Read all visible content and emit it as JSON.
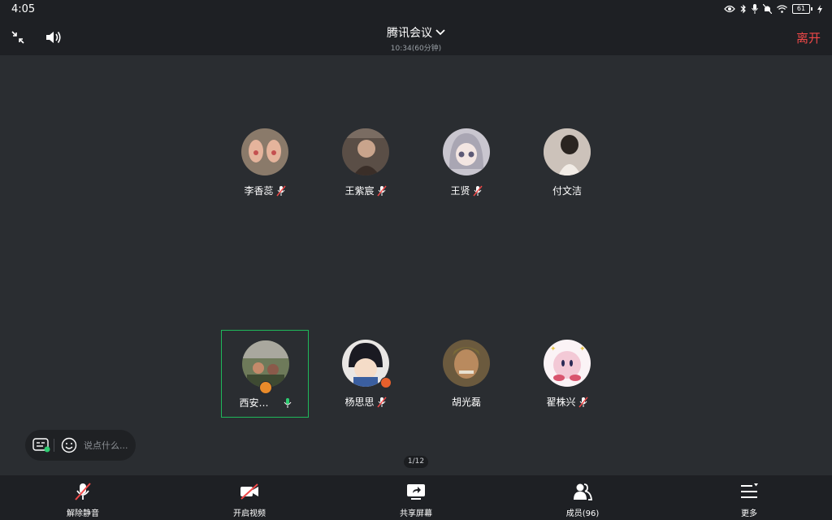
{
  "status_bar": {
    "time": "4:05",
    "battery": "61",
    "icons": [
      "eye-icon",
      "bluetooth-icon",
      "mic-icon",
      "mute-bell-icon",
      "wifi-icon",
      "battery-icon",
      "charging-icon"
    ]
  },
  "header": {
    "title": "腾讯会议",
    "subtitle": "10:34(60分钟)",
    "leave_label": "离开"
  },
  "participants": [
    {
      "name": "李香蕊",
      "mic": "muted",
      "avatar_color": "#8a7a6a"
    },
    {
      "name": "王紫宸",
      "mic": "muted",
      "avatar_color": "#5a4e46"
    },
    {
      "name": "王贤",
      "mic": "muted",
      "avatar_color": "#c9c6cf"
    },
    {
      "name": "付文洁",
      "mic": "none",
      "avatar_color": "#b8aaa0"
    },
    {
      "name": "西安…",
      "mic": "on",
      "avatar_color": "#6e7a5a",
      "active": true,
      "host": true
    },
    {
      "name": "杨思思",
      "mic": "muted",
      "avatar_color": "#e9e6e4"
    },
    {
      "name": "胡光磊",
      "mic": "none",
      "avatar_color": "#6b5a3e"
    },
    {
      "name": "翟株兴",
      "mic": "muted",
      "avatar_color": "#f3c9d6"
    }
  ],
  "chat": {
    "placeholder": "说点什么..."
  },
  "pager": {
    "text": "1/12"
  },
  "toolbar": {
    "unmute_label": "解除静音",
    "video_label": "开启视频",
    "share_label": "共享屏幕",
    "members_label": "成员(96)",
    "more_label": "更多"
  },
  "colors": {
    "accent_red": "#f04848",
    "active_green": "#1fb85a",
    "background": "#2a2d31",
    "bar": "#1e2024"
  }
}
